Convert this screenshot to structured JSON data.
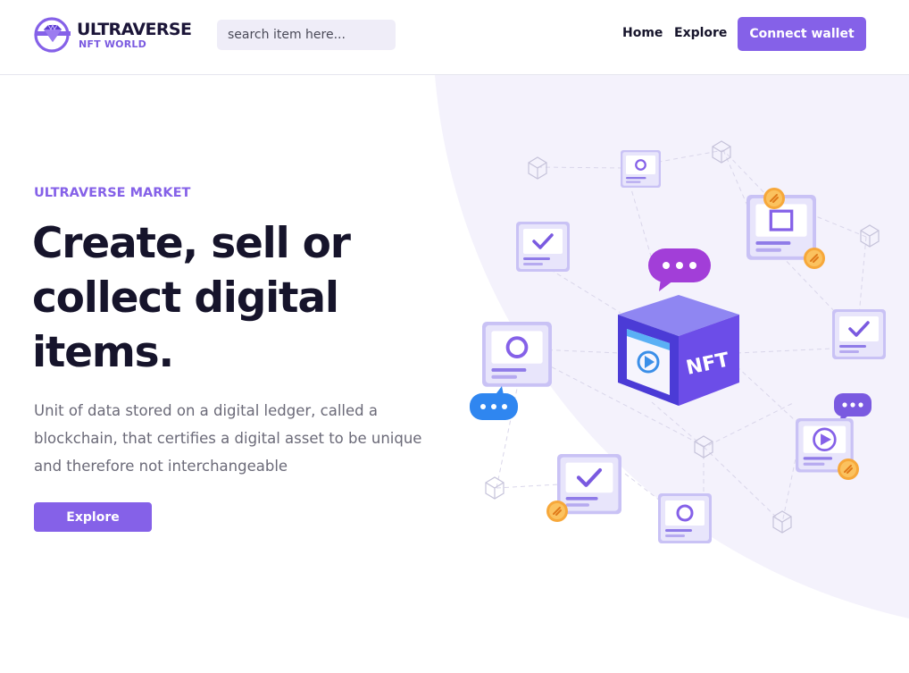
{
  "header": {
    "logo_title": "ULTRAVERSE",
    "logo_subtitle": "NFT WORLD",
    "search_placeholder": "search item here...",
    "nav": {
      "home": "Home",
      "explore": "Explore"
    },
    "connect_label": "Connect wallet"
  },
  "hero": {
    "eyebrow": "ULTRAVERSE MARKET",
    "headline": "Create, sell or collect digital items.",
    "description": "Unit of data stored on a digital ledger, called a blockchain, that certifies a digital asset to be unique and therefore not interchangeable",
    "cta_label": "Explore"
  },
  "illustration": {
    "cube_label": "NFT",
    "icons": [
      "chat-bubble-icon",
      "check-card-icon",
      "circle-card-icon",
      "play-card-icon",
      "square-card-icon",
      "coin-link-icon",
      "wireframe-cube-icon"
    ]
  },
  "colors": {
    "accent": "#8561e8",
    "bg_shape": "#f4f2fc",
    "text_dark": "#16142b",
    "text_muted": "#6b6a78",
    "search_bg": "#efedf8",
    "chat_blue": "#2f86f0",
    "coin": "#f7a83a"
  }
}
